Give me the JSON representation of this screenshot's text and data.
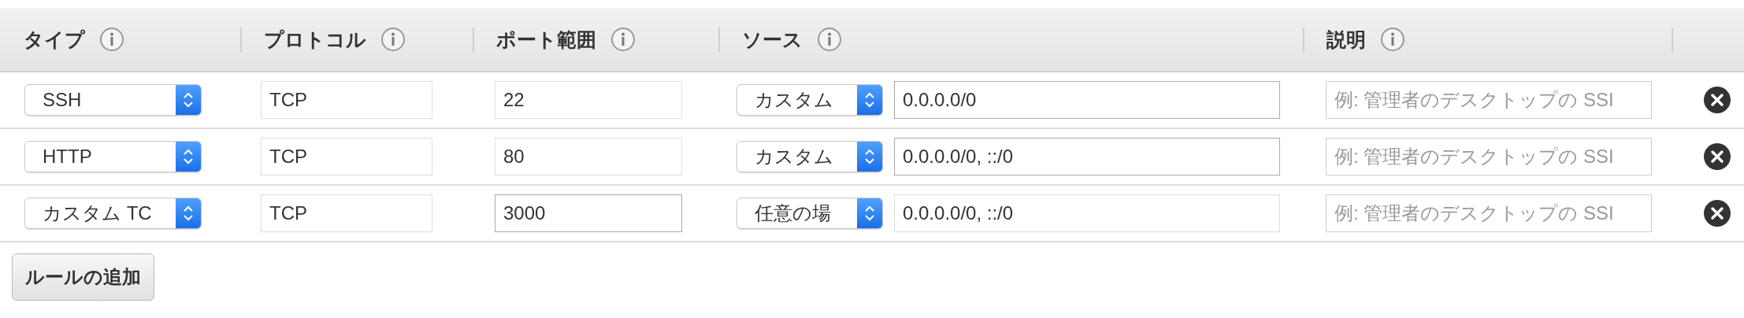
{
  "table": {
    "columns": [
      "タイプ",
      "プロトコル",
      "ポート範囲",
      "ソース",
      "説明"
    ],
    "rows": [
      {
        "type": "SSH",
        "protocol": {
          "value": "TCP",
          "disabled": true
        },
        "port": {
          "value": "22",
          "disabled": true
        },
        "source": "カスタム",
        "cidr": {
          "value": "0.0.0.0/0",
          "disabled": false
        },
        "description": {
          "placeholder": "例: 管理者のデスクトップの SSI"
        }
      },
      {
        "type": "HTTP",
        "protocol": {
          "value": "TCP",
          "disabled": true
        },
        "port": {
          "value": "80",
          "disabled": true
        },
        "source": "カスタム",
        "cidr": {
          "value": "0.0.0.0/0, ::/0",
          "disabled": false
        },
        "description": {
          "placeholder": "例: 管理者のデスクトップの SSI"
        }
      },
      {
        "type": "カスタム TC",
        "protocol": {
          "value": "TCP",
          "disabled": true
        },
        "port": {
          "value": "3000",
          "disabled": false
        },
        "source": "任意の場",
        "cidr": {
          "value": "0.0.0.0/0, ::/0",
          "disabled": true
        },
        "description": {
          "placeholder": "例: 管理者のデスクトップの SSI"
        }
      }
    ]
  },
  "add_button": "ルールの追加"
}
